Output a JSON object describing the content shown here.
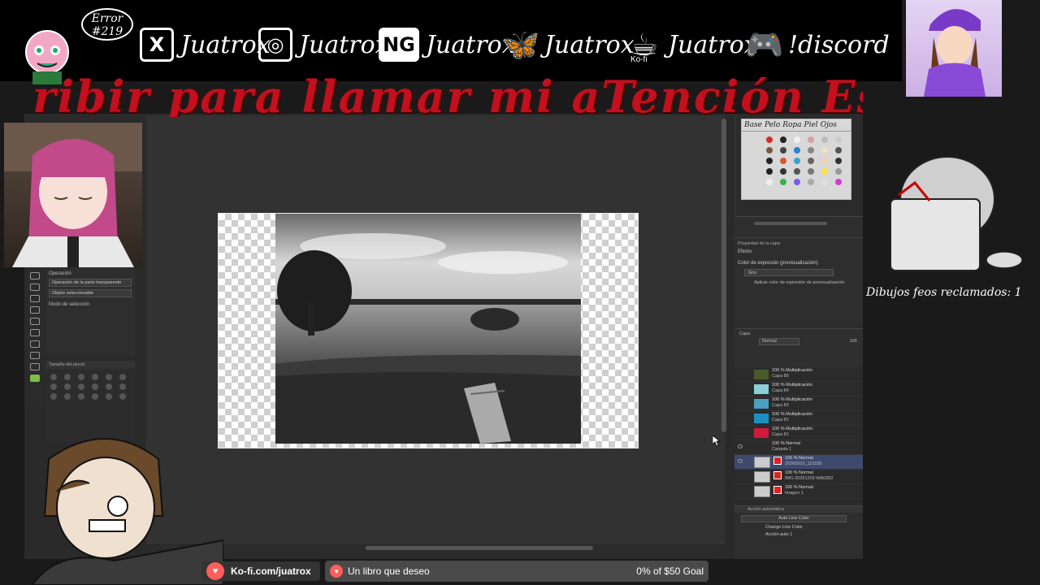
{
  "overlay": {
    "error_badge": "Error\n#219",
    "socials": [
      {
        "icon": "x-twitter-icon",
        "glyph": "X",
        "handle": "Juatrox"
      },
      {
        "icon": "instagram-icon",
        "glyph": "◎",
        "handle": "Juatrox"
      },
      {
        "icon": "newgrounds-icon",
        "glyph": "NG",
        "handle": "Juatrox"
      },
      {
        "icon": "bluesky-butterfly-icon",
        "glyph": "🦋",
        "handle": "Juatrox"
      },
      {
        "icon": "kofi-cup-icon",
        "glyph": "☕",
        "handle": "Juatrox"
      },
      {
        "icon": "gamepad-icon",
        "glyph": "🎮",
        "handle": "!discord"
      }
    ],
    "kofi_label": "Ko-fi",
    "ticker": "ribir para llamar mi aTención Esc",
    "claims_text": "Dibujos feos reclamados: 1",
    "kofi_link": "Ko-fi.com/juatrox",
    "goal_title": "Un libro que deseo",
    "goal_progress": "0% of $50 Goal"
  },
  "app": {
    "tool_property": {
      "title": "Operación",
      "field1": "Operación de la parte transparente",
      "field2": "Objeto seleccionable",
      "mode_label": "Modo de selección"
    },
    "brush_size_title": "Tamaño del pincel",
    "palette_tabs": [
      "Base",
      "Pelo",
      "Ropa",
      "Piel",
      "Ojos"
    ],
    "palette_colors": [
      "#d22b2b",
      "#222222",
      "#f0f0f0",
      "#d9a0a0",
      "#bbbbbb",
      "#cccccc",
      "#7a5a3a",
      "#444444",
      "#2a7fd4",
      "#888888",
      "#f0e0c0",
      "#555555",
      "#222222",
      "#d45a2a",
      "#3aa0d4",
      "#666666",
      "#f5d0b0",
      "#333333",
      "#222222",
      "#333333",
      "#555555",
      "#777777",
      "#ffe040",
      "#999999",
      "#eeeeee",
      "#3ab04a",
      "#7a5af0",
      "#aaaaaa",
      "#e0e0e0",
      "#d43ad4"
    ],
    "property_panel": {
      "header": "Propiedad de la capa",
      "effect_label": "Efecto",
      "color_label": "Color de expresión (previsualización)",
      "color_value": "Gris",
      "apply_button": "Aplicar color de expresión de previsualización"
    },
    "layer_panel": {
      "header": "Capa",
      "blend_mode": "Normal",
      "opacity": "100"
    },
    "layers": [
      {
        "line1": "100 % Multiplicación",
        "line2": "Capa 85",
        "color": "#4a5a2a"
      },
      {
        "line1": "100 % Multiplicación",
        "line2": "Capa 84",
        "color": "#8ad0d8"
      },
      {
        "line1": "100 % Multiplicación",
        "line2": "Capa 83",
        "color": "#4aa0c0"
      },
      {
        "line1": "100 % Multiplicación",
        "line2": "Capa 82",
        "color": "#1a90c0"
      },
      {
        "line1": "100 % Multiplicación",
        "line2": "Capa 81",
        "color": "#d01a3a"
      },
      {
        "line1": "100 % Normal",
        "line2": "Carpeta 1",
        "color": ""
      },
      {
        "line1": "100 % Normal",
        "line2": "20260910_110335",
        "color": "",
        "selected": true
      },
      {
        "line1": "100 % Normal",
        "line2": "IMG-20251203-WA0282",
        "color": ""
      },
      {
        "line1": "100 % Normal",
        "line2": "Imagen 1",
        "color": ""
      }
    ],
    "auto_action": {
      "header": "Acción automática",
      "set": "Auto Line Color",
      "items": [
        "Change Line Color",
        "Acción auto 1"
      ]
    }
  }
}
